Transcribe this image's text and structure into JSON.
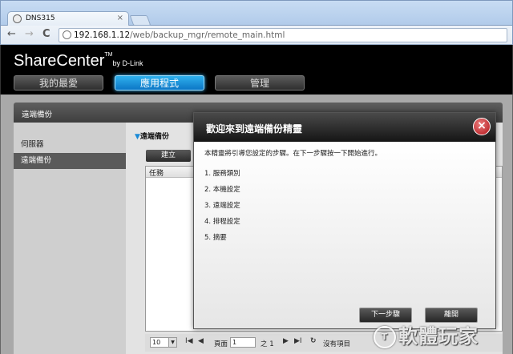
{
  "browser": {
    "tab_title": "DNS315",
    "tab_close": "×",
    "nav": {
      "back": "←",
      "forward": "→",
      "reload": "C"
    },
    "address_host": "192.168.1.12",
    "address_path": "/web/backup_mgr/remote_main.html"
  },
  "header": {
    "brand": "ShareCenter",
    "brand_tm": "TM",
    "brand_by": "by D-Link",
    "nav_tabs": [
      {
        "label": "我的最愛"
      },
      {
        "label": "應用程式",
        "active": true
      },
      {
        "label": "管理"
      }
    ]
  },
  "section": {
    "title": "遠端備份"
  },
  "sidebar": {
    "items": [
      {
        "label": "伺服器"
      },
      {
        "label": "遠端備份",
        "active": true
      }
    ]
  },
  "content": {
    "title": "遠端備份",
    "create_label": "建立",
    "grid_header": "任務",
    "pager": {
      "page_size": "10",
      "page_label": "頁面",
      "page_value": "1",
      "of_label": "之 1",
      "empty_label": "沒有項目"
    }
  },
  "dialog": {
    "title": "歡迎來到遠端備份精靈",
    "close": "×",
    "intro": "本精靈將引導您設定的步驟。在下一步驟按一下開始進行。",
    "steps": [
      "1. 服務類別",
      "2. 本機設定",
      "3. 遠端設定",
      "4. 排程設定",
      "5. 摘要"
    ],
    "next_label": "下一步驟",
    "exit_label": "離開"
  },
  "watermark": {
    "logo": "T",
    "text": "軟體玩家"
  },
  "colors": {
    "accent": "#1a8ad6",
    "close_red": "#b1141a"
  }
}
